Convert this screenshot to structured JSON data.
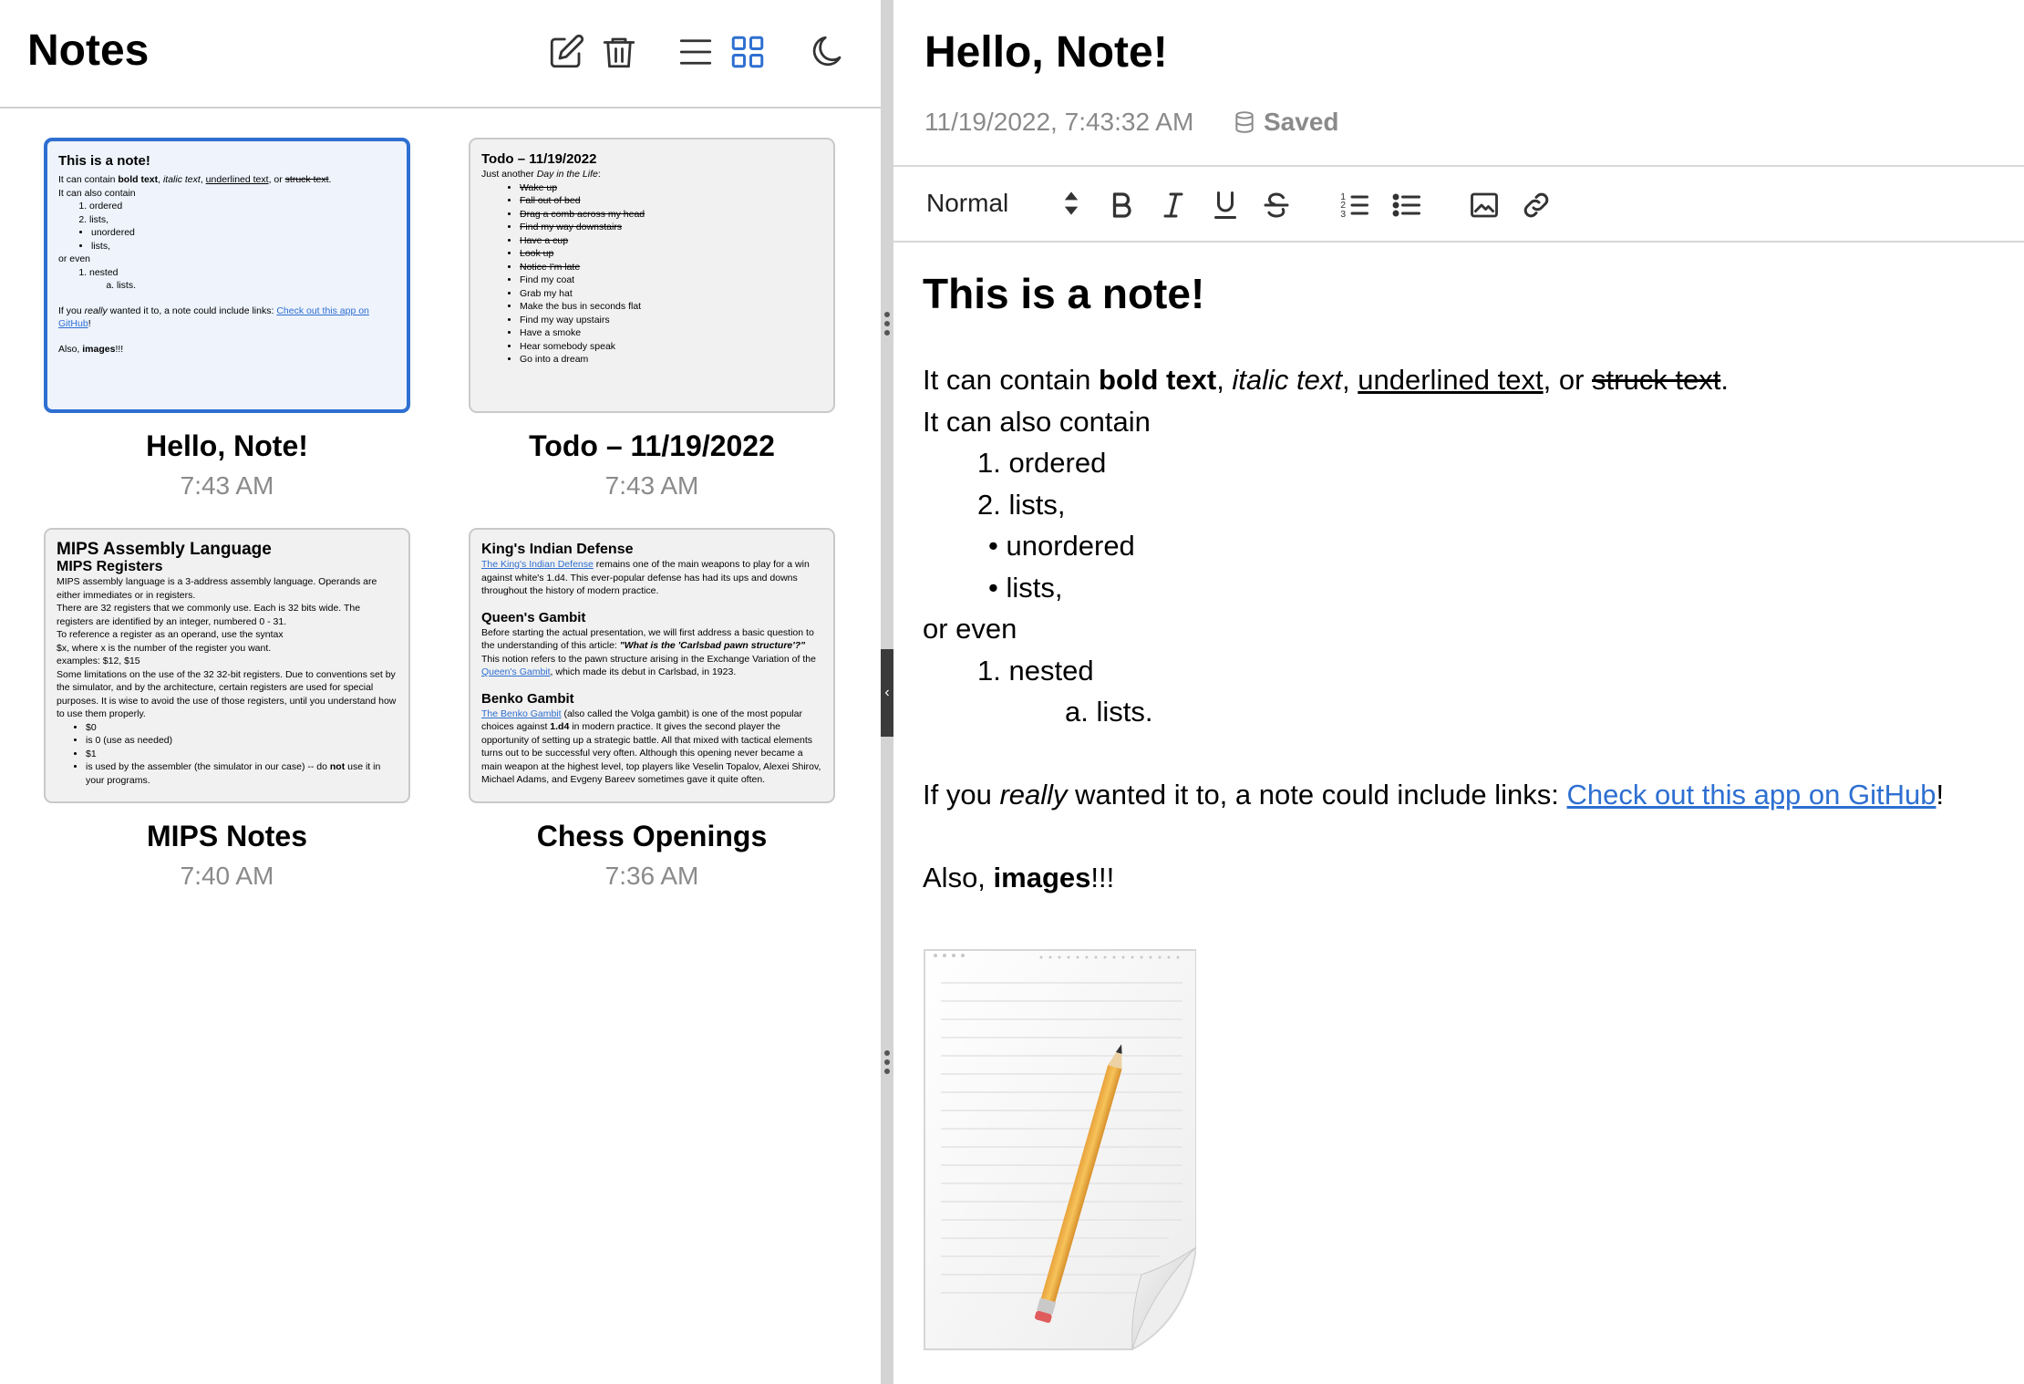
{
  "sidebar": {
    "title": "Notes",
    "notes": [
      {
        "title": "Hello, Note!",
        "time": "7:43 AM",
        "preview": {
          "heading": "This is a note!",
          "line1_a": "It can contain ",
          "line1_bold": "bold text",
          "line1_b": ", ",
          "line1_italic": "italic text",
          "line1_c": ", ",
          "line1_underline": "underlined text",
          "line1_d": ", or ",
          "line1_strike": "struck text",
          "line1_e": ".",
          "line2": "It can also contain",
          "ol": [
            "ordered",
            "lists,"
          ],
          "ul": [
            "unordered",
            "lists,"
          ],
          "or_even": "or even",
          "nested": "nested",
          "nested_sub": "lists.",
          "link_a": "If you ",
          "link_really": "really",
          "link_b": " wanted it to, a note could include links: ",
          "link_text": "Check out this app on GitHub",
          "link_c": "!",
          "also_a": "Also, ",
          "also_bold": "images",
          "also_b": "!!!"
        }
      },
      {
        "title": "Todo – 11/19/2022",
        "time": "7:43 AM",
        "preview": {
          "heading": "Todo – 11/19/2022",
          "intro_a": "Just another ",
          "intro_italic": "Day in the Life",
          "intro_b": ":",
          "done": [
            "Wake up",
            "Fall out of bed",
            "Drag a comb across my head",
            "Find my way downstairs",
            "Have a cup",
            "Look up",
            "Notice I'm late"
          ],
          "todo": [
            "Find my coat",
            "Grab my hat",
            "Make the bus in seconds flat",
            "Find my way upstairs",
            "Have a smoke",
            "Hear somebody speak",
            "Go into a dream"
          ]
        }
      },
      {
        "title": "MIPS Notes",
        "time": "7:40 AM",
        "preview": {
          "heading": "MIPS Assembly Language",
          "subheading": "MIPS Registers",
          "p1": "MIPS assembly language is a 3-address assembly language. Operands are either immediates or in registers.",
          "p2": "There are 32 registers that we commonly use. Each is 32 bits wide. The registers are identified by an integer, numbered 0 - 31.",
          "p3": "To reference a register as an operand, use the syntax",
          "p4": "$x, where x is the number of the register you want.",
          "p5": "examples: $12, $15",
          "p6": "Some limitations on the use of the 32 32-bit registers. Due to conventions set by the simulator, and by the architecture, certain registers are used for special purposes. It is wise to avoid the use of those registers, until you understand how to use them properly.",
          "items": [
            "$0",
            "is 0 (use as needed)",
            "$1"
          ],
          "last_a": "is used by the assembler (the simulator in our case) -- do ",
          "last_bold": "not",
          "last_b": " use it in your programs."
        }
      },
      {
        "title": "Chess Openings",
        "time": "7:36 AM",
        "preview": {
          "h1": "King's Indian Defense",
          "p1_link": "The King's Indian Defense",
          "p1": " remains one of the main weapons to play for a win against white's 1.d4. This ever-popular defense has had its ups and downs throughout the history of modern practice.",
          "h2": "Queen's Gambit",
          "p2_a": "Before starting the actual presentation, we will first address a basic question to the understanding of this article: ",
          "p2_bi": "\"What is the 'Carlsbad pawn structure'?\"",
          "p2_b": " This notion refers to the pawn structure arising in the Exchange Variation of the ",
          "p2_link": "Queen's Gambit",
          "p2_c": ", which made its debut in Carlsbad, in 1923.",
          "h3": "Benko Gambit",
          "p3_link": "The Benko Gambit",
          "p3_a": " (also called the Volga gambit) is one of the most popular choices against ",
          "p3_bold": "1.d4",
          "p3_b": " in modern practice. It gives the second player the opportunity of setting up a strategic battle. All that mixed with tactical elements turns out to be successful very often. Although this opening never became a main weapon at the highest level, top players like Veselin Topalov, Alexei Shirov, Michael Adams, and Evgeny Bareev sometimes gave it quite often."
        }
      }
    ]
  },
  "editor": {
    "title": "Hello, Note!",
    "timestamp": "11/19/2022, 7:43:32 AM",
    "saved_label": "Saved",
    "format_select": "Normal",
    "content": {
      "heading": "This is a note!",
      "line1_a": "It can contain ",
      "line1_bold": "bold text",
      "line1_b": ", ",
      "line1_italic": "italic text",
      "line1_c": ", ",
      "line1_underline": "underlined text",
      "line1_d": ", or ",
      "line1_strike": "struck text",
      "line1_e": ".",
      "line2": "It can also contain",
      "ol1_num": "1.",
      "ol1": "ordered",
      "ol2_num": "2.",
      "ol2": "lists,",
      "ul1": "unordered",
      "ul2": "lists,",
      "or_even": "or even",
      "nested_num": "1.",
      "nested": "nested",
      "sub_num": "a.",
      "sub": "lists.",
      "link_a": "If you ",
      "link_really": "really",
      "link_b": " wanted it to, a note could include links: ",
      "link_text": "Check out this app on GitHub",
      "link_c": "!",
      "also_a": "Also, ",
      "also_bold": "images",
      "also_b": "!!!"
    }
  },
  "colors": {
    "accent": "#2e6fd1",
    "muted": "#8a8a8a",
    "divider": "#d4d4d4"
  },
  "icons": [
    "compose-icon",
    "trash-icon",
    "list-view-icon",
    "grid-view-icon",
    "dark-mode-icon",
    "database-icon",
    "bold-icon",
    "italic-icon",
    "underline-icon",
    "strikethrough-icon",
    "ordered-list-icon",
    "bullet-list-icon",
    "image-icon",
    "link-icon"
  ]
}
